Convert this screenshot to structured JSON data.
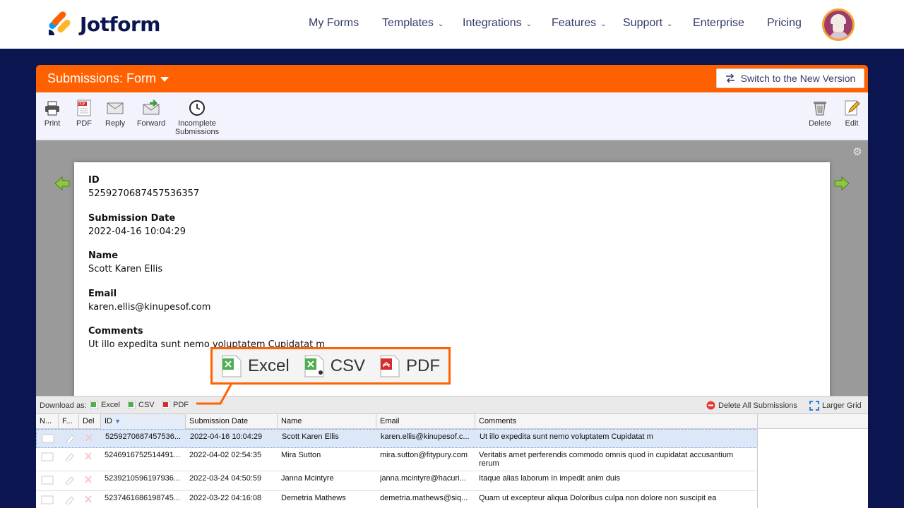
{
  "brand": {
    "name": "Jotform"
  },
  "nav": {
    "items": [
      {
        "label": "My Forms",
        "dropdown": false
      },
      {
        "label": "Templates",
        "dropdown": true
      },
      {
        "label": "Integrations",
        "dropdown": true
      },
      {
        "label": "Features",
        "dropdown": true
      },
      {
        "label": "Support",
        "dropdown": true
      },
      {
        "label": "Enterprise",
        "dropdown": false
      },
      {
        "label": "Pricing",
        "dropdown": false
      }
    ],
    "chevron": "⌄"
  },
  "panel": {
    "title": "Submissions: Form",
    "switch_label": "Switch to the New Version",
    "accent": "#ff6100"
  },
  "toolbar": {
    "left": [
      {
        "id": "print",
        "label": "Print",
        "icon": "printer-icon"
      },
      {
        "id": "pdf",
        "label": "PDF",
        "icon": "pdf-file-icon"
      },
      {
        "id": "reply",
        "label": "Reply",
        "icon": "envelope-icon"
      },
      {
        "id": "forward",
        "label": "Forward",
        "icon": "envelope-forward-icon"
      },
      {
        "id": "incomplete",
        "label": "Incomplete Submissions",
        "icon": "clock-icon"
      }
    ],
    "right": [
      {
        "id": "delete",
        "label": "Delete",
        "icon": "trash-icon"
      },
      {
        "id": "edit",
        "label": "Edit",
        "icon": "pencil-icon"
      }
    ]
  },
  "submission": {
    "fields": [
      {
        "label": "ID",
        "value": "5259270687457536357"
      },
      {
        "label": "Submission Date",
        "value": "2022-04-16 10:04:29"
      },
      {
        "label": "Name",
        "value": "Scott Karen Ellis"
      },
      {
        "label": "Email",
        "value": "karen.ellis@kinupesof.com"
      },
      {
        "label": "Comments",
        "value": "Ut illo expedita sunt nemo voluptatem Cupidatat m"
      }
    ]
  },
  "callout": {
    "items": [
      {
        "label": "Excel",
        "icon": "excel-file-icon"
      },
      {
        "label": "CSV",
        "icon": "csv-file-icon"
      },
      {
        "label": "PDF",
        "icon": "pdf-file-icon"
      }
    ]
  },
  "download_bar": {
    "label": "Download as:",
    "excel": "Excel",
    "csv": "CSV",
    "pdf": "PDF",
    "delete_all": "Delete All Submissions",
    "larger_grid": "Larger Grid"
  },
  "grid": {
    "columns": [
      "N...",
      "F...",
      "Del",
      "ID",
      "Submission Date",
      "Name",
      "Email",
      "Comments"
    ],
    "rows": [
      {
        "id": "5259270687457536...",
        "date": "2022-04-16 10:04:29",
        "name": "Scott Karen Ellis",
        "email": "karen.ellis@kinupesof.c...",
        "comments": "Ut illo expedita sunt nemo voluptatem Cupidatat m",
        "selected": true
      },
      {
        "id": "5246916752514491...",
        "date": "2022-04-02 02:54:35",
        "name": "Mira Sutton",
        "email": "mira.sutton@fitypury.com",
        "comments": "Veritatis amet perferendis commodo omnis quod in cupidatat accusantium rerum",
        "selected": false
      },
      {
        "id": "5239210596197936...",
        "date": "2022-03-24 04:50:59",
        "name": "Janna Mcintyre",
        "email": "janna.mcintyre@hacuri...",
        "comments": "Itaque alias laborum In impedit anim duis",
        "selected": false
      },
      {
        "id": "5237461686198745...",
        "date": "2022-03-22 04:16:08",
        "name": "Demetria Mathews",
        "email": "demetria.mathews@siq...",
        "comments": "Quam ut excepteur aliqua Doloribus culpa non dolore non suscipit ea",
        "selected": false
      }
    ]
  }
}
